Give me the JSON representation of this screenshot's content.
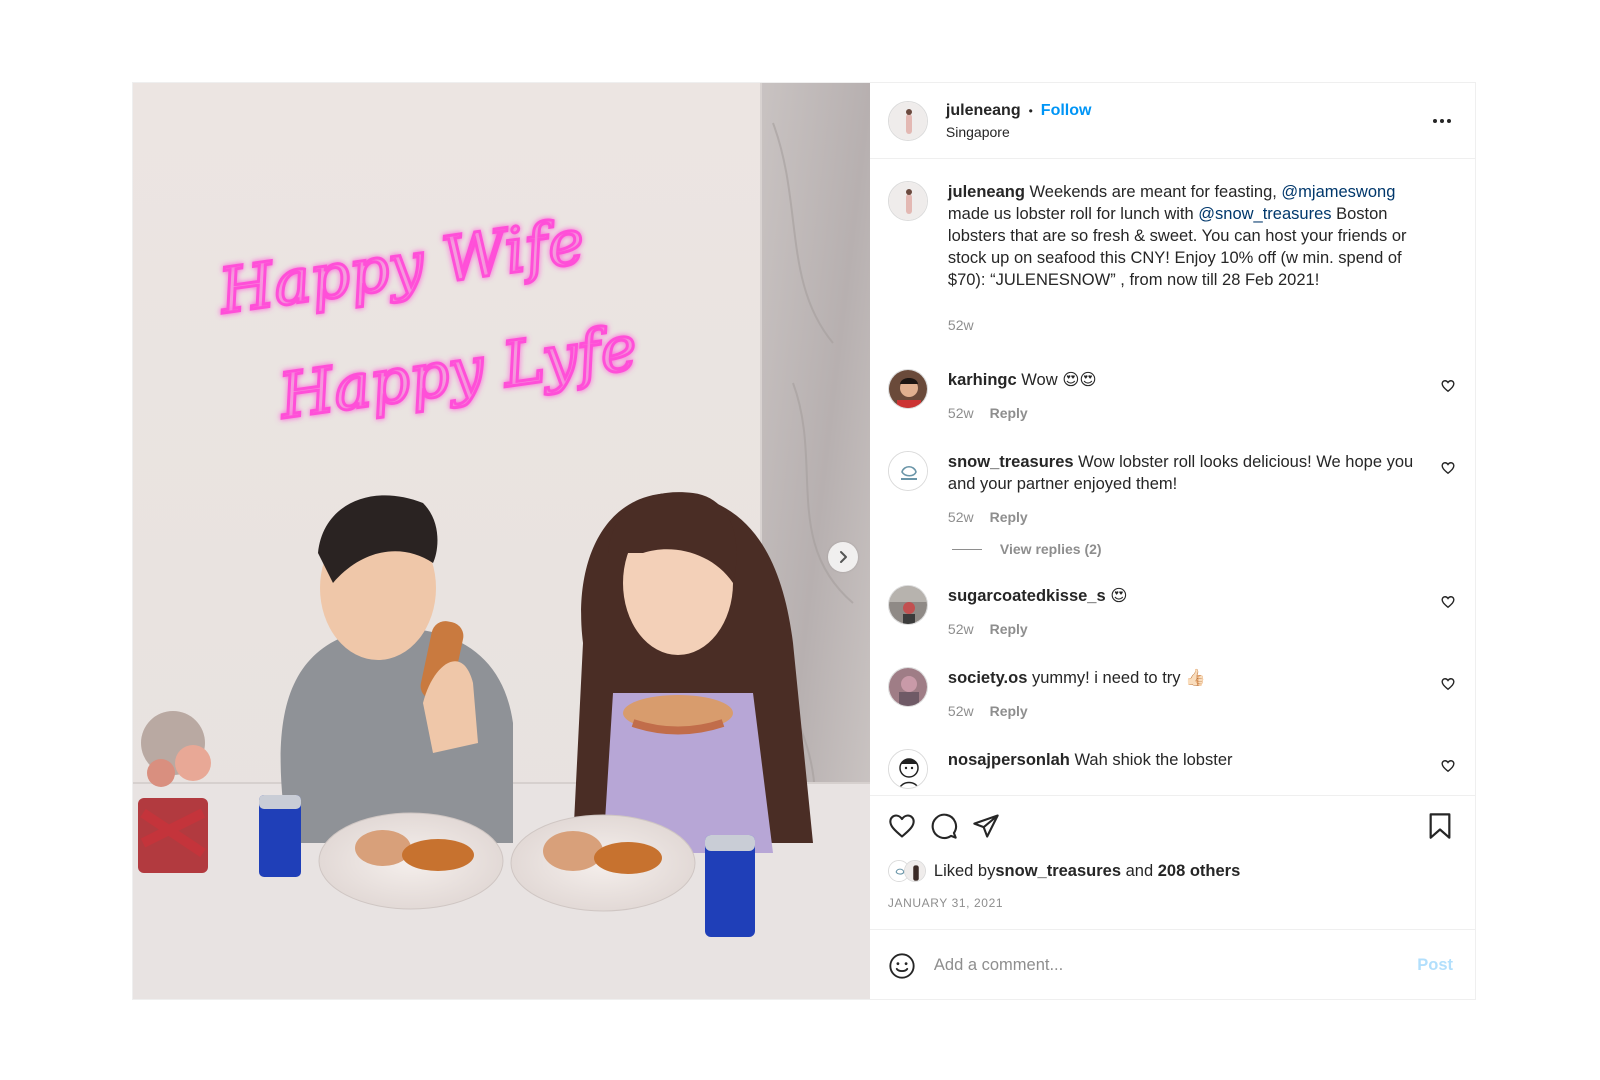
{
  "post": {
    "author": {
      "username": "juleneang",
      "follow_label": "Follow",
      "dot": "•",
      "location": "Singapore",
      "avatar_icon": "profile-photo"
    },
    "media": {
      "neon_sign_line1": "Happy Wife",
      "neon_sign_line2": "Happy Lyfe",
      "neon_color": "#ff4fd8",
      "next_icon": "chevron-right-icon"
    },
    "caption": {
      "username": "juleneang",
      "text_part1": " Weekends are meant for feasting, ",
      "mention1": "@mjameswong",
      "text_part2": " made us lobster roll for lunch with ",
      "mention2": "@snow_treasures",
      "text_part3": " Boston lobsters that are so fresh & sweet. You can host your friends or stock up on seafood this CNY! Enjoy 10% off (w min. spend of $70): “JULENESNOW” , from now till 28 Feb 2021!",
      "age": "52w"
    },
    "comments": [
      {
        "username": "karhingc",
        "text": " Wow 😍😍",
        "age": "52w",
        "reply_label": "Reply"
      },
      {
        "username": "snow_treasures",
        "text": " Wow lobster roll looks delicious! We hope you and your partner enjoyed them!",
        "age": "52w",
        "reply_label": "Reply"
      },
      {
        "username": "sugarcoatedkisse_s",
        "text": " 😍",
        "age": "52w",
        "reply_label": "Reply"
      },
      {
        "username": "society.os",
        "text": " yummy! i need to try 👍🏻",
        "age": "52w",
        "reply_label": "Reply"
      },
      {
        "username": "nosajpersonlah",
        "text": " Wah shiok the lobster"
      }
    ],
    "view_replies_label": "View replies (2)",
    "likes": {
      "prefix": "Liked by ",
      "user": "snow_treasures",
      "middle": " and ",
      "others": "208 others"
    },
    "date": "JANUARY 31, 2021",
    "add_comment": {
      "placeholder": "Add a comment...",
      "post_label": "Post"
    },
    "colors": {
      "link_blue": "#0095f6",
      "mention_blue": "#00376b",
      "muted": "#8e8e8e",
      "post_disabled": "#b2dffc"
    }
  }
}
